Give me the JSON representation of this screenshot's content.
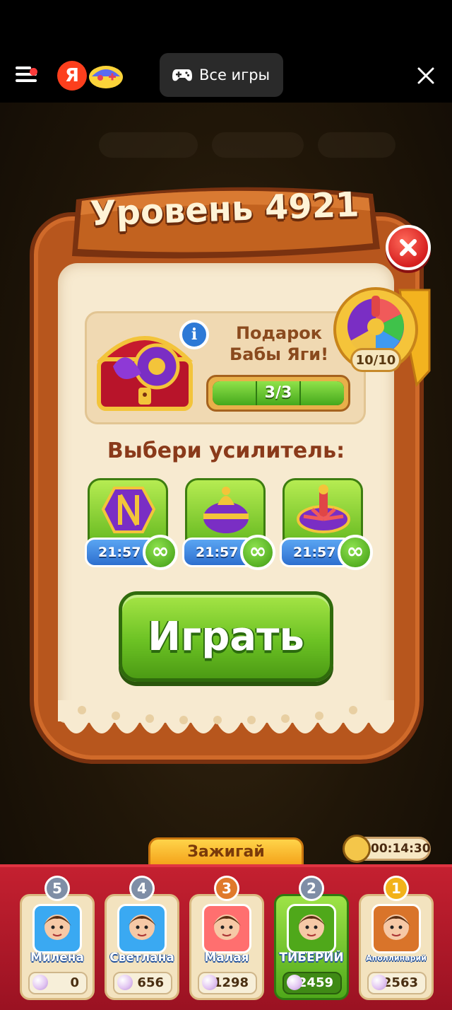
{
  "topbar": {
    "brand_letter": "Я",
    "all_games_label": "Все игры",
    "icons": [
      "menu-icon",
      "yandex-logo",
      "games-logo",
      "gamepad-icon",
      "close-icon"
    ]
  },
  "panel": {
    "title": "Уровень 4921",
    "gift": {
      "title": "Подарок Бабы Яги!",
      "progress_text": "3/3",
      "progress_fraction": 1.0,
      "wheel_count": "10/10"
    },
    "choose_label": "Выбери усилитель:",
    "boosters": [
      {
        "timer": "21:57",
        "infinite": "∞",
        "icon": "hammer-barrel-icon"
      },
      {
        "timer": "21:57",
        "infinite": "∞",
        "icon": "bomb-icon"
      },
      {
        "timer": "21:57",
        "infinite": "∞",
        "icon": "spinning-top-icon"
      }
    ],
    "play_label": "Играть"
  },
  "event": {
    "tab_label": "Зажигай",
    "timer": "00:14:30"
  },
  "leaderboard": [
    {
      "rank": "5",
      "name": "Милена",
      "score": "0"
    },
    {
      "rank": "4",
      "name": "Светлана",
      "score": "656"
    },
    {
      "rank": "3",
      "name": "Малая",
      "score": "1298"
    },
    {
      "rank": "2",
      "name": "ТИБЕРИЙ",
      "score": "2459"
    },
    {
      "rank": "1",
      "name": "Аполлинарий",
      "score": "2563"
    }
  ],
  "colors": {
    "panel_wood": "#b7561d",
    "panel_paper": "#f7ead0",
    "play_green": "#6cc224",
    "board_red": "#c42030",
    "rank_gold": "#f2b21a",
    "rank_bronze": "#e0792a",
    "rank_silver": "#7f8ea6"
  }
}
